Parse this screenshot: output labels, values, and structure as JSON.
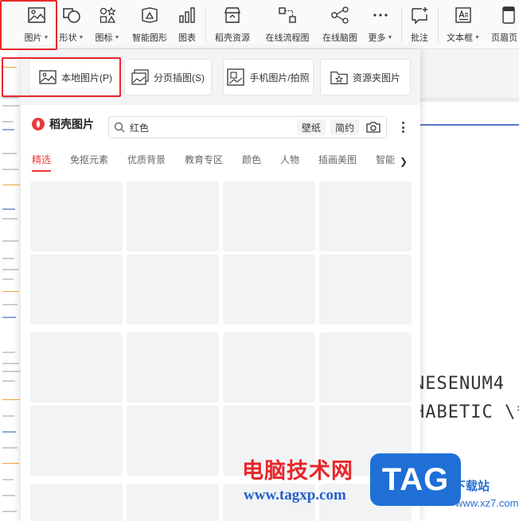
{
  "ribbon": {
    "tools": [
      {
        "id": "picture",
        "label": "图片",
        "icon": "image-icon",
        "caret": true
      },
      {
        "id": "shape",
        "label": "形状",
        "icon": "shape-icon",
        "caret": true
      },
      {
        "id": "icon",
        "label": "图标",
        "icon": "icons-icon",
        "caret": true
      },
      {
        "id": "smartart",
        "label": "智能图形",
        "icon": "smartart-icon",
        "caret": false
      },
      {
        "id": "chart",
        "label": "图表",
        "icon": "chart-icon",
        "caret": false
      },
      {
        "id": "docer",
        "label": "稻壳资源",
        "icon": "store-icon",
        "caret": false
      },
      {
        "id": "flowchart",
        "label": "在线流程图",
        "icon": "flowchart-icon",
        "caret": false
      },
      {
        "id": "mindmap",
        "label": "在线脑图",
        "icon": "mindmap-icon",
        "caret": false
      },
      {
        "id": "more",
        "label": "更多",
        "icon": "more-icon",
        "caret": true
      },
      {
        "id": "comment",
        "label": "批注",
        "icon": "comment-icon",
        "caret": false
      },
      {
        "id": "textbox",
        "label": "文本框",
        "icon": "textbox-icon",
        "caret": true
      },
      {
        "id": "header",
        "label": "页眉页",
        "icon": "header-icon",
        "caret": false
      }
    ]
  },
  "panel": {
    "sources": [
      {
        "label": "本地图片(P)",
        "icon": "local-image-icon"
      },
      {
        "label": "分页插图(S)",
        "icon": "paged-image-icon"
      },
      {
        "label": "手机图片/拍照",
        "icon": "phone-image-icon"
      },
      {
        "label": "资源夹图片",
        "icon": "folder-image-icon"
      }
    ],
    "library": {
      "title": "稻壳图片",
      "search_value": "红色",
      "chip_wallpaper": "壁纸",
      "chip_simple": "简约",
      "tabs": [
        "精选",
        "免抠元素",
        "优质背景",
        "教育专区",
        "颜色",
        "人物",
        "插画美图",
        "智能抠"
      ],
      "active_tab": 0
    }
  },
  "document": {
    "line1": "NESENUM4",
    "line2": "HABETIC \\*"
  },
  "watermark": {
    "cn": "电脑技术网",
    "url": "www.tagxp.com",
    "tag": "TAG",
    "xz_name": "下载站",
    "xz_url": "www.xz7.com"
  },
  "colors": {
    "accent": "#e8393a",
    "highlight_box": "#e8282b",
    "doc_rule": "#5b76c7",
    "tile": "#f2f3f5"
  }
}
